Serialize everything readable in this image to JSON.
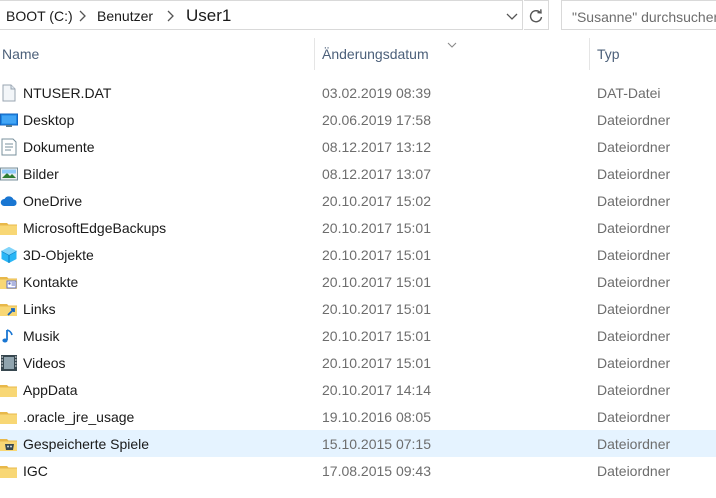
{
  "address_bar": {
    "crumbs": [
      "BOOT (C:)",
      "Benutzer",
      "User1"
    ]
  },
  "search": {
    "placeholder": "\"Susanne\" durchsuchen"
  },
  "columns": {
    "name": "Name",
    "date": "Änderungsdatum",
    "type": "Typ"
  },
  "files": [
    {
      "name": "NTUSER.DAT",
      "date": "03.02.2019 08:39",
      "type": "DAT-Datei",
      "icon": "file-icon"
    },
    {
      "name": "Desktop",
      "date": "20.06.2019 17:58",
      "type": "Dateiordner",
      "icon": "desktop-folder-icon"
    },
    {
      "name": "Dokumente",
      "date": "08.12.2017 13:12",
      "type": "Dateiordner",
      "icon": "documents-folder-icon"
    },
    {
      "name": "Bilder",
      "date": "08.12.2017 13:07",
      "type": "Dateiordner",
      "icon": "pictures-folder-icon"
    },
    {
      "name": "OneDrive",
      "date": "20.10.2017 15:02",
      "type": "Dateiordner",
      "icon": "onedrive-icon"
    },
    {
      "name": "MicrosoftEdgeBackups",
      "date": "20.10.2017 15:01",
      "type": "Dateiordner",
      "icon": "folder-icon"
    },
    {
      "name": "3D-Objekte",
      "date": "20.10.2017 15:01",
      "type": "Dateiordner",
      "icon": "3d-objects-icon"
    },
    {
      "name": "Kontakte",
      "date": "20.10.2017 15:01",
      "type": "Dateiordner",
      "icon": "contacts-folder-icon"
    },
    {
      "name": "Links",
      "date": "20.10.2017 15:01",
      "type": "Dateiordner",
      "icon": "links-folder-icon"
    },
    {
      "name": "Musik",
      "date": "20.10.2017 15:01",
      "type": "Dateiordner",
      "icon": "music-icon"
    },
    {
      "name": "Videos",
      "date": "20.10.2017 15:01",
      "type": "Dateiordner",
      "icon": "videos-folder-icon"
    },
    {
      "name": "AppData",
      "date": "20.10.2017 14:14",
      "type": "Dateiordner",
      "icon": "folder-icon"
    },
    {
      "name": ".oracle_jre_usage",
      "date": "19.10.2016 08:05",
      "type": "Dateiordner",
      "icon": "folder-icon"
    },
    {
      "name": "Gespeicherte Spiele",
      "date": "15.10.2015 07:15",
      "type": "Dateiordner",
      "icon": "saved-games-folder-icon",
      "selected": true
    },
    {
      "name": "IGC",
      "date": "17.08.2015 09:43",
      "type": "Dateiordner",
      "icon": "folder-icon"
    }
  ],
  "colors": {
    "folder": "#f8d775",
    "folder_dark": "#e8b84a",
    "selection": "#e5f3ff",
    "header_text": "#4c607a",
    "secondary_text": "#6d6d6d"
  }
}
